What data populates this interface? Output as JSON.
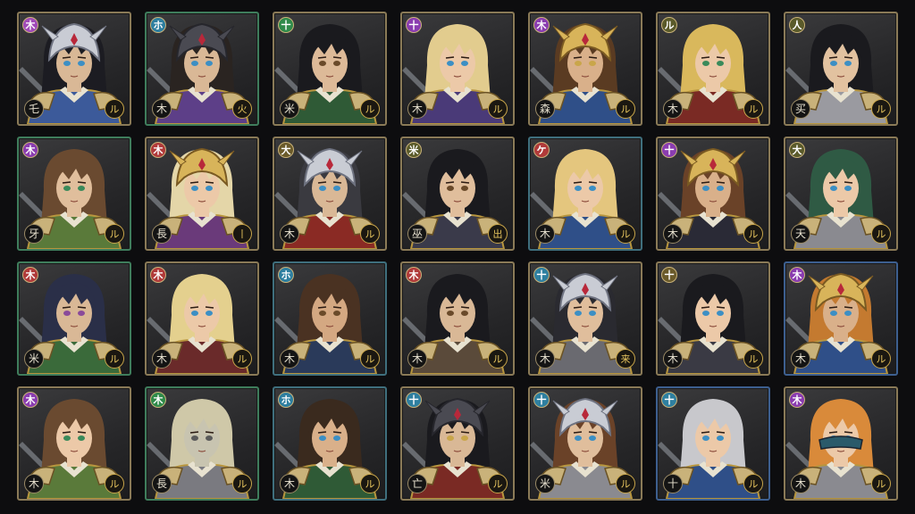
{
  "heroes": [
    {
      "elem": "木",
      "elem_color": "#a04ab8",
      "class_glyph": "乇",
      "skill_glyph": "ル",
      "hair": "#1c1c22",
      "skin": "#d9b896",
      "eyes": "#3c8fc4",
      "armor": "#3c5a9a",
      "helm": "silver",
      "border": "gold"
    },
    {
      "elem": "ホ",
      "elem_color": "#2e7fa0",
      "class_glyph": "木",
      "skill_glyph": "火",
      "hair": "#2a2421",
      "skin": "#d9b896",
      "eyes": "#3c8fc4",
      "armor": "#5d3f88",
      "helm": "dark",
      "border": "green"
    },
    {
      "elem": "十",
      "elem_color": "#2f8a4a",
      "class_glyph": "米",
      "skill_glyph": "ル",
      "hair": "#1a1a1e",
      "skin": "#ddba98",
      "eyes": "#6a4a2a",
      "armor": "#2f5a36",
      "helm": "none",
      "border": "gold"
    },
    {
      "elem": "十",
      "elem_color": "#8a3cb0",
      "class_glyph": "木",
      "skill_glyph": "ル",
      "hair": "#e2cc8e",
      "skin": "#ecc9a8",
      "eyes": "#3c8fc4",
      "armor": "#4a3a78",
      "helm": "none",
      "border": "gold"
    },
    {
      "elem": "木",
      "elem_color": "#8a3cb0",
      "class_glyph": "森",
      "skill_glyph": "ル",
      "hair": "#5a3b22",
      "skin": "#d9b08a",
      "eyes": "#c9a64a",
      "armor": "#2f4f88",
      "helm": "gold",
      "border": "gold"
    },
    {
      "elem": "ル",
      "elem_color": "#5a5a2a",
      "class_glyph": "木",
      "skill_glyph": "ル",
      "hair": "#d9b85c",
      "skin": "#ecc9a8",
      "eyes": "#3a8a5a",
      "armor": "#7a2a24",
      "helm": "none",
      "border": "gold"
    },
    {
      "elem": "人",
      "elem_color": "#5a5a2a",
      "class_glyph": "买",
      "skill_glyph": "ル",
      "hair": "#1a1a1e",
      "skin": "#e2c2a0",
      "eyes": "#3c8fc4",
      "armor": "#9a9aa0",
      "helm": "none",
      "border": "gold"
    },
    {
      "elem": "木",
      "elem_color": "#8a3cb0",
      "class_glyph": "牙",
      "skill_glyph": "ル",
      "hair": "#6a4a30",
      "skin": "#e0be9c",
      "eyes": "#3a8a5a",
      "armor": "#5a7a3a",
      "helm": "none",
      "border": "green"
    },
    {
      "elem": "木",
      "elem_color": "#b03a3a",
      "class_glyph": "長",
      "skill_glyph": "丨",
      "hair": "#e4d6a8",
      "skin": "#ecc9a8",
      "eyes": "#3c8fc4",
      "armor": "#6a3a7a",
      "helm": "gold",
      "border": "gold"
    },
    {
      "elem": "大",
      "elem_color": "#6a5a2a",
      "class_glyph": "木",
      "skill_glyph": "ル",
      "hair": "#3a3a40",
      "skin": "#d9b896",
      "eyes": "#3c8fc4",
      "armor": "#8a2a24",
      "helm": "silver",
      "border": "gold"
    },
    {
      "elem": "米",
      "elem_color": "#5a5a2a",
      "class_glyph": "巫",
      "skill_glyph": "出",
      "hair": "#1a1a1e",
      "skin": "#e0be9c",
      "eyes": "#6a4a2a",
      "armor": "#3a3a4a",
      "helm": "none",
      "border": "gold"
    },
    {
      "elem": "ケ",
      "elem_color": "#b03a3a",
      "class_glyph": "木",
      "skill_glyph": "ル",
      "hair": "#e4c67e",
      "skin": "#ecc9a8",
      "eyes": "#3c8fc4",
      "armor": "#2f4f88",
      "helm": "none",
      "border": "teal"
    },
    {
      "elem": "十",
      "elem_color": "#8a3cb0",
      "class_glyph": "木",
      "skill_glyph": "ル",
      "hair": "#6a4228",
      "skin": "#d9b08a",
      "eyes": "#3c8fc4",
      "armor": "#2a2a36",
      "helm": "gold",
      "border": "gold"
    },
    {
      "elem": "大",
      "elem_color": "#5a5a2a",
      "class_glyph": "天",
      "skill_glyph": "ル",
      "hair": "#2f5a44",
      "skin": "#ecc9a8",
      "eyes": "#3c8fc4",
      "armor": "#8a8a90",
      "helm": "none",
      "border": "gold"
    },
    {
      "elem": "木",
      "elem_color": "#b03a3a",
      "class_glyph": "米",
      "skill_glyph": "ル",
      "hair": "#2a2f48",
      "skin": "#d9b896",
      "eyes": "#8a4a9a",
      "armor": "#3a6a3a",
      "helm": "none",
      "border": "green"
    },
    {
      "elem": "木",
      "elem_color": "#b03a3a",
      "class_glyph": "木",
      "skill_glyph": "ル",
      "hair": "#e4d08e",
      "skin": "#ecc9a8",
      "eyes": "#3c8fc4",
      "armor": "#6a2a2a",
      "helm": "none",
      "border": "gold"
    },
    {
      "elem": "ホ",
      "elem_color": "#2e7fa0",
      "class_glyph": "木",
      "skill_glyph": "ル",
      "hair": "#4a3222",
      "skin": "#d4a882",
      "eyes": "#6a4a2a",
      "armor": "#2a3a5a",
      "helm": "none",
      "border": "teal"
    },
    {
      "elem": "木",
      "elem_color": "#b03a3a",
      "class_glyph": "木",
      "skill_glyph": "ル",
      "hair": "#1a1a1e",
      "skin": "#d9b896",
      "eyes": "#6a4a2a",
      "armor": "#5a4a3a",
      "helm": "none",
      "border": "gold"
    },
    {
      "elem": "十",
      "elem_color": "#2e7fa0",
      "class_glyph": "木",
      "skill_glyph": "来",
      "hair": "#2a2a30",
      "skin": "#e0be9c",
      "eyes": "#3c8fc4",
      "armor": "#6a6a70",
      "helm": "silver",
      "border": "gold"
    },
    {
      "elem": "十",
      "elem_color": "#6a5a2a",
      "class_glyph": "木",
      "skill_glyph": "ル",
      "hair": "#1a1a1e",
      "skin": "#ecc9a8",
      "eyes": "#3c8fc4",
      "armor": "#3a3a44",
      "helm": "none",
      "border": "gold"
    },
    {
      "elem": "木",
      "elem_color": "#8a3cb0",
      "class_glyph": "木",
      "skill_glyph": "ル",
      "hair": "#c47a30",
      "skin": "#d9b08a",
      "eyes": "#3c8fc4",
      "armor": "#2f4f88",
      "helm": "gold",
      "border": "blue"
    },
    {
      "elem": "木",
      "elem_color": "#8a3cb0",
      "class_glyph": "木",
      "skill_glyph": "ル",
      "hair": "#6a4a30",
      "skin": "#ecc9a8",
      "eyes": "#3a8a5a",
      "armor": "#5a7a3a",
      "helm": "none",
      "border": "gold"
    },
    {
      "elem": "木",
      "elem_color": "#2f8a4a",
      "class_glyph": "長",
      "skill_glyph": "ル",
      "hair": "#cfc8a8",
      "skin": "#c8c4b0",
      "eyes": "#5a5a5a",
      "armor": "#7a7a80",
      "helm": "none",
      "border": "green"
    },
    {
      "elem": "ホ",
      "elem_color": "#2e7fa0",
      "class_glyph": "木",
      "skill_glyph": "ル",
      "hair": "#3a2a1e",
      "skin": "#d9b08a",
      "eyes": "#3c8fc4",
      "armor": "#2f5a36",
      "helm": "none",
      "border": "teal"
    },
    {
      "elem": "十",
      "elem_color": "#2e7fa0",
      "class_glyph": "亡",
      "skill_glyph": "ル",
      "hair": "#1a1a1e",
      "skin": "#d9b896",
      "eyes": "#c9a64a",
      "armor": "#7a2a24",
      "helm": "dark",
      "border": "gold"
    },
    {
      "elem": "十",
      "elem_color": "#2e7fa0",
      "class_glyph": "米",
      "skill_glyph": "ル",
      "hair": "#6a4228",
      "skin": "#e0be9c",
      "eyes": "#3c8fc4",
      "armor": "#8a8a90",
      "helm": "silver",
      "border": "gold"
    },
    {
      "elem": "十",
      "elem_color": "#2e7fa0",
      "class_glyph": "十",
      "skill_glyph": "ル",
      "hair": "#c8c8cc",
      "skin": "#ecc9a8",
      "eyes": "#3c8fc4",
      "armor": "#2f4f88",
      "helm": "none",
      "border": "blue"
    },
    {
      "elem": "木",
      "elem_color": "#8a3cb0",
      "class_glyph": "木",
      "skill_glyph": "ル",
      "hair": "#d98a3a",
      "skin": "#ecc9a8",
      "eyes": "#3c8fc4",
      "armor": "#8a8a90",
      "helm": "mask",
      "border": "gold"
    }
  ]
}
